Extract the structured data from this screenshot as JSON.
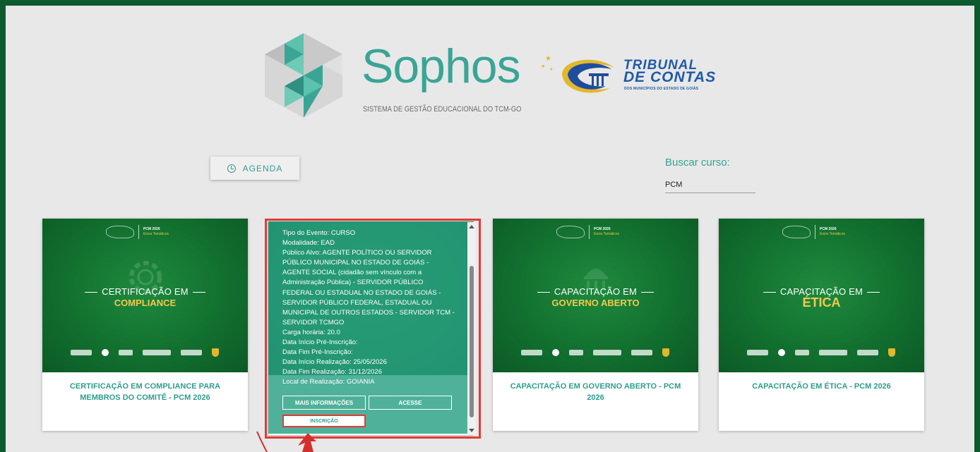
{
  "header": {
    "brand": "Sophos",
    "brand_subtitle": "SISTEMA DE GESTÃO EDUCACIONAL DO TCM-GO",
    "partner_line1": "TRIBUNAL",
    "partner_line2": "DE CONTAS",
    "partner_line3": "DOS MUNICÍPIOS DO ESTADO DE GOIÁS"
  },
  "agenda": {
    "label": "AGENDA",
    "icon": "clock-icon"
  },
  "search": {
    "label": "Buscar curso:",
    "value": "PCM"
  },
  "cards": [
    {
      "head_title": "PCM 2026",
      "head_sub": "Eixos Temáticos",
      "line1": "CERTIFICAÇÃO EM",
      "line2": "COMPLIANCE",
      "title": "CERTIFICAÇÃO EM COMPLIANCE PARA MEMBROS DO COMITÊ - PCM 2026"
    },
    {
      "details": [
        "Tipo do Evento: CURSO",
        "Modalidade: EAD",
        "Público Alvo: AGENTE POLÍTICO OU SERVIDOR PÚBLICO MUNICIPAL NO ESTADO DE GOIÁS - AGENTE SOCIAL (cidadão sem vínculo com a Administração Pública) - SERVIDOR PÚBLICO FEDERAL OU ESTADUAL NO ESTADO DE GOIÁS - SERVIDOR PÚBLICO FEDERAL, ESTADUAL OU MUNICIPAL DE OUTROS ESTADOS - SERVIDOR TCM - SERVIDOR TCMGO",
        "Carga horária: 20.0",
        "Data Início Pré-Inscrição:",
        "Data Fim Pré-Inscrição:",
        "Data Início Realização: 25/05/2026",
        "Data Fim Realização: 31/12/2026",
        "Local de Realização: GOIANIA"
      ],
      "more_label": "MAIS INFORMAÇÕES",
      "access_label": "ACESSE",
      "enroll_label": "INSCRIÇÃO"
    },
    {
      "head_title": "PCM 2026",
      "head_sub": "Eixos Temáticos",
      "line1": "CAPACITAÇÃO EM",
      "line2": "GOVERNO ABERTO",
      "title": "CAPACITAÇÃO EM GOVERNO ABERTO - PCM 2026"
    },
    {
      "head_title": "PCM 2026",
      "head_sub": "Eixos Temáticos",
      "line1": "CAPACITAÇÃO EM",
      "line2": "ÉTICA",
      "title": "CAPACITAÇÃO EM ÉTICA - PCM 2026"
    }
  ],
  "colors": {
    "background": "#0c5a2e",
    "accent": "#2f9d8c",
    "highlight": "#e53935",
    "gold": "#f2c94c"
  }
}
